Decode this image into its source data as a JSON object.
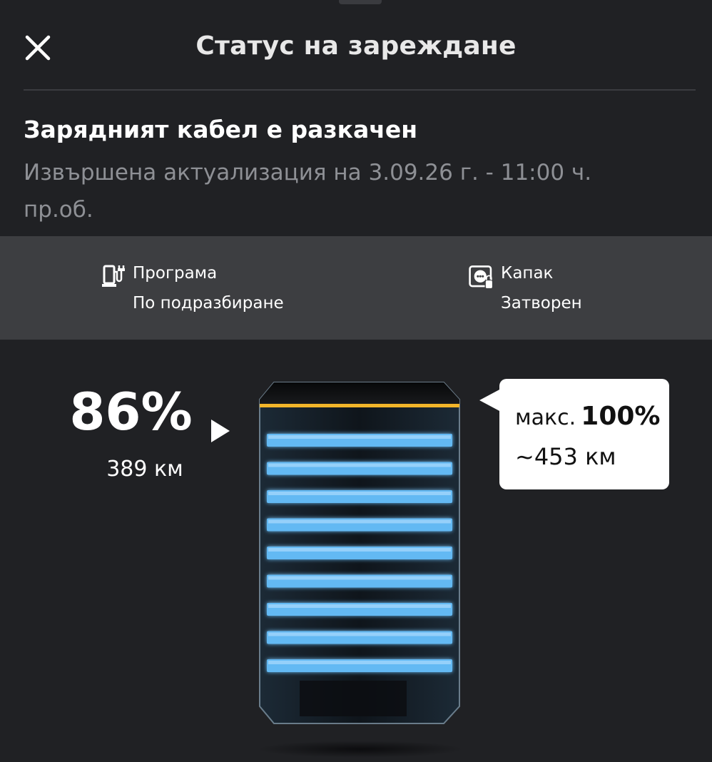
{
  "header": {
    "title": "Статус на зареждане",
    "close_icon": "close-icon"
  },
  "status": {
    "title": "Зарядният кабел е разкачен",
    "subtitle": "Извършена актуализация на 3.09.26 г. - 11:00 ч. пр.об."
  },
  "info": {
    "program": {
      "icon": "charging-station-icon",
      "label": "Програма",
      "value": "По подразбиране"
    },
    "flap": {
      "icon": "charging-flap-icon",
      "label": "Капак",
      "value": "Затворен"
    }
  },
  "battery": {
    "percent_text": "86%",
    "percent": 86,
    "range_text": "389 км",
    "max_label": "макс.",
    "max_percent": "100%",
    "max_range": "~453 км",
    "segments": 9
  },
  "colors": {
    "background": "#202124",
    "band": "#3d3e41",
    "segment": "#63b9f3",
    "limit_line": "#f2b52a"
  }
}
